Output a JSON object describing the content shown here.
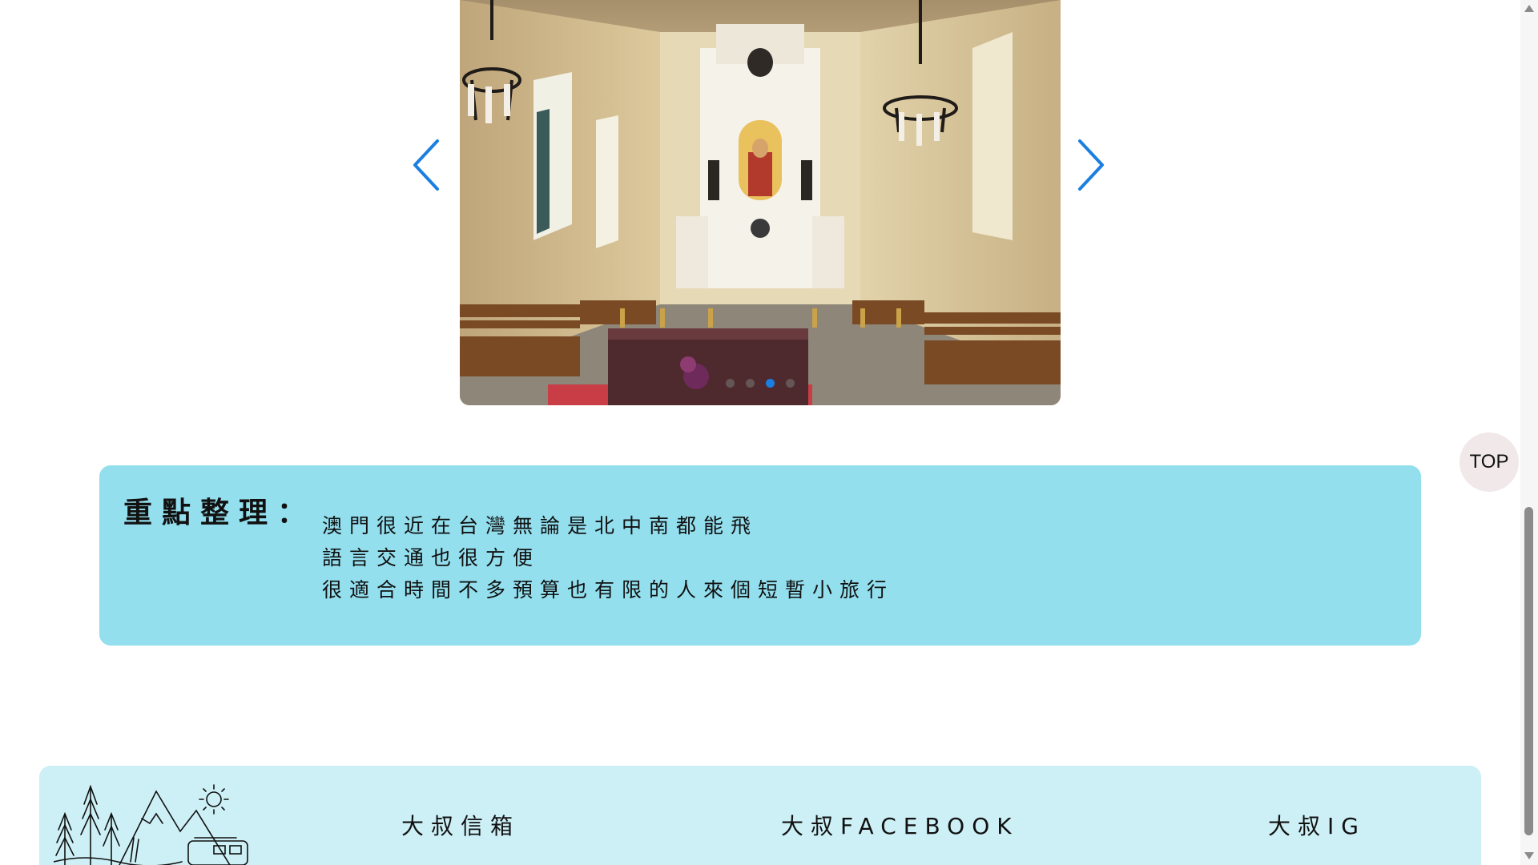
{
  "carousel": {
    "prev_icon": "chevron-left-icon",
    "next_icon": "chevron-right-icon",
    "slide_count": 4,
    "active_index": 2,
    "arrow_color": "#1a7fe0"
  },
  "summary": {
    "title": "重點整理：",
    "lines": [
      "澳門很近在台灣無論是北中南都能飛",
      "語言交通也很方便",
      "很適合時間不多預算也有限的人來個短暫小旅行"
    ],
    "background": "#93dfee"
  },
  "top_button": {
    "label": "TOP"
  },
  "footer": {
    "mail_label": "大叔信箱",
    "facebook_label": "大叔FACEBOOK",
    "ig_label": "大叔IG",
    "background": "#cdf0f6"
  }
}
